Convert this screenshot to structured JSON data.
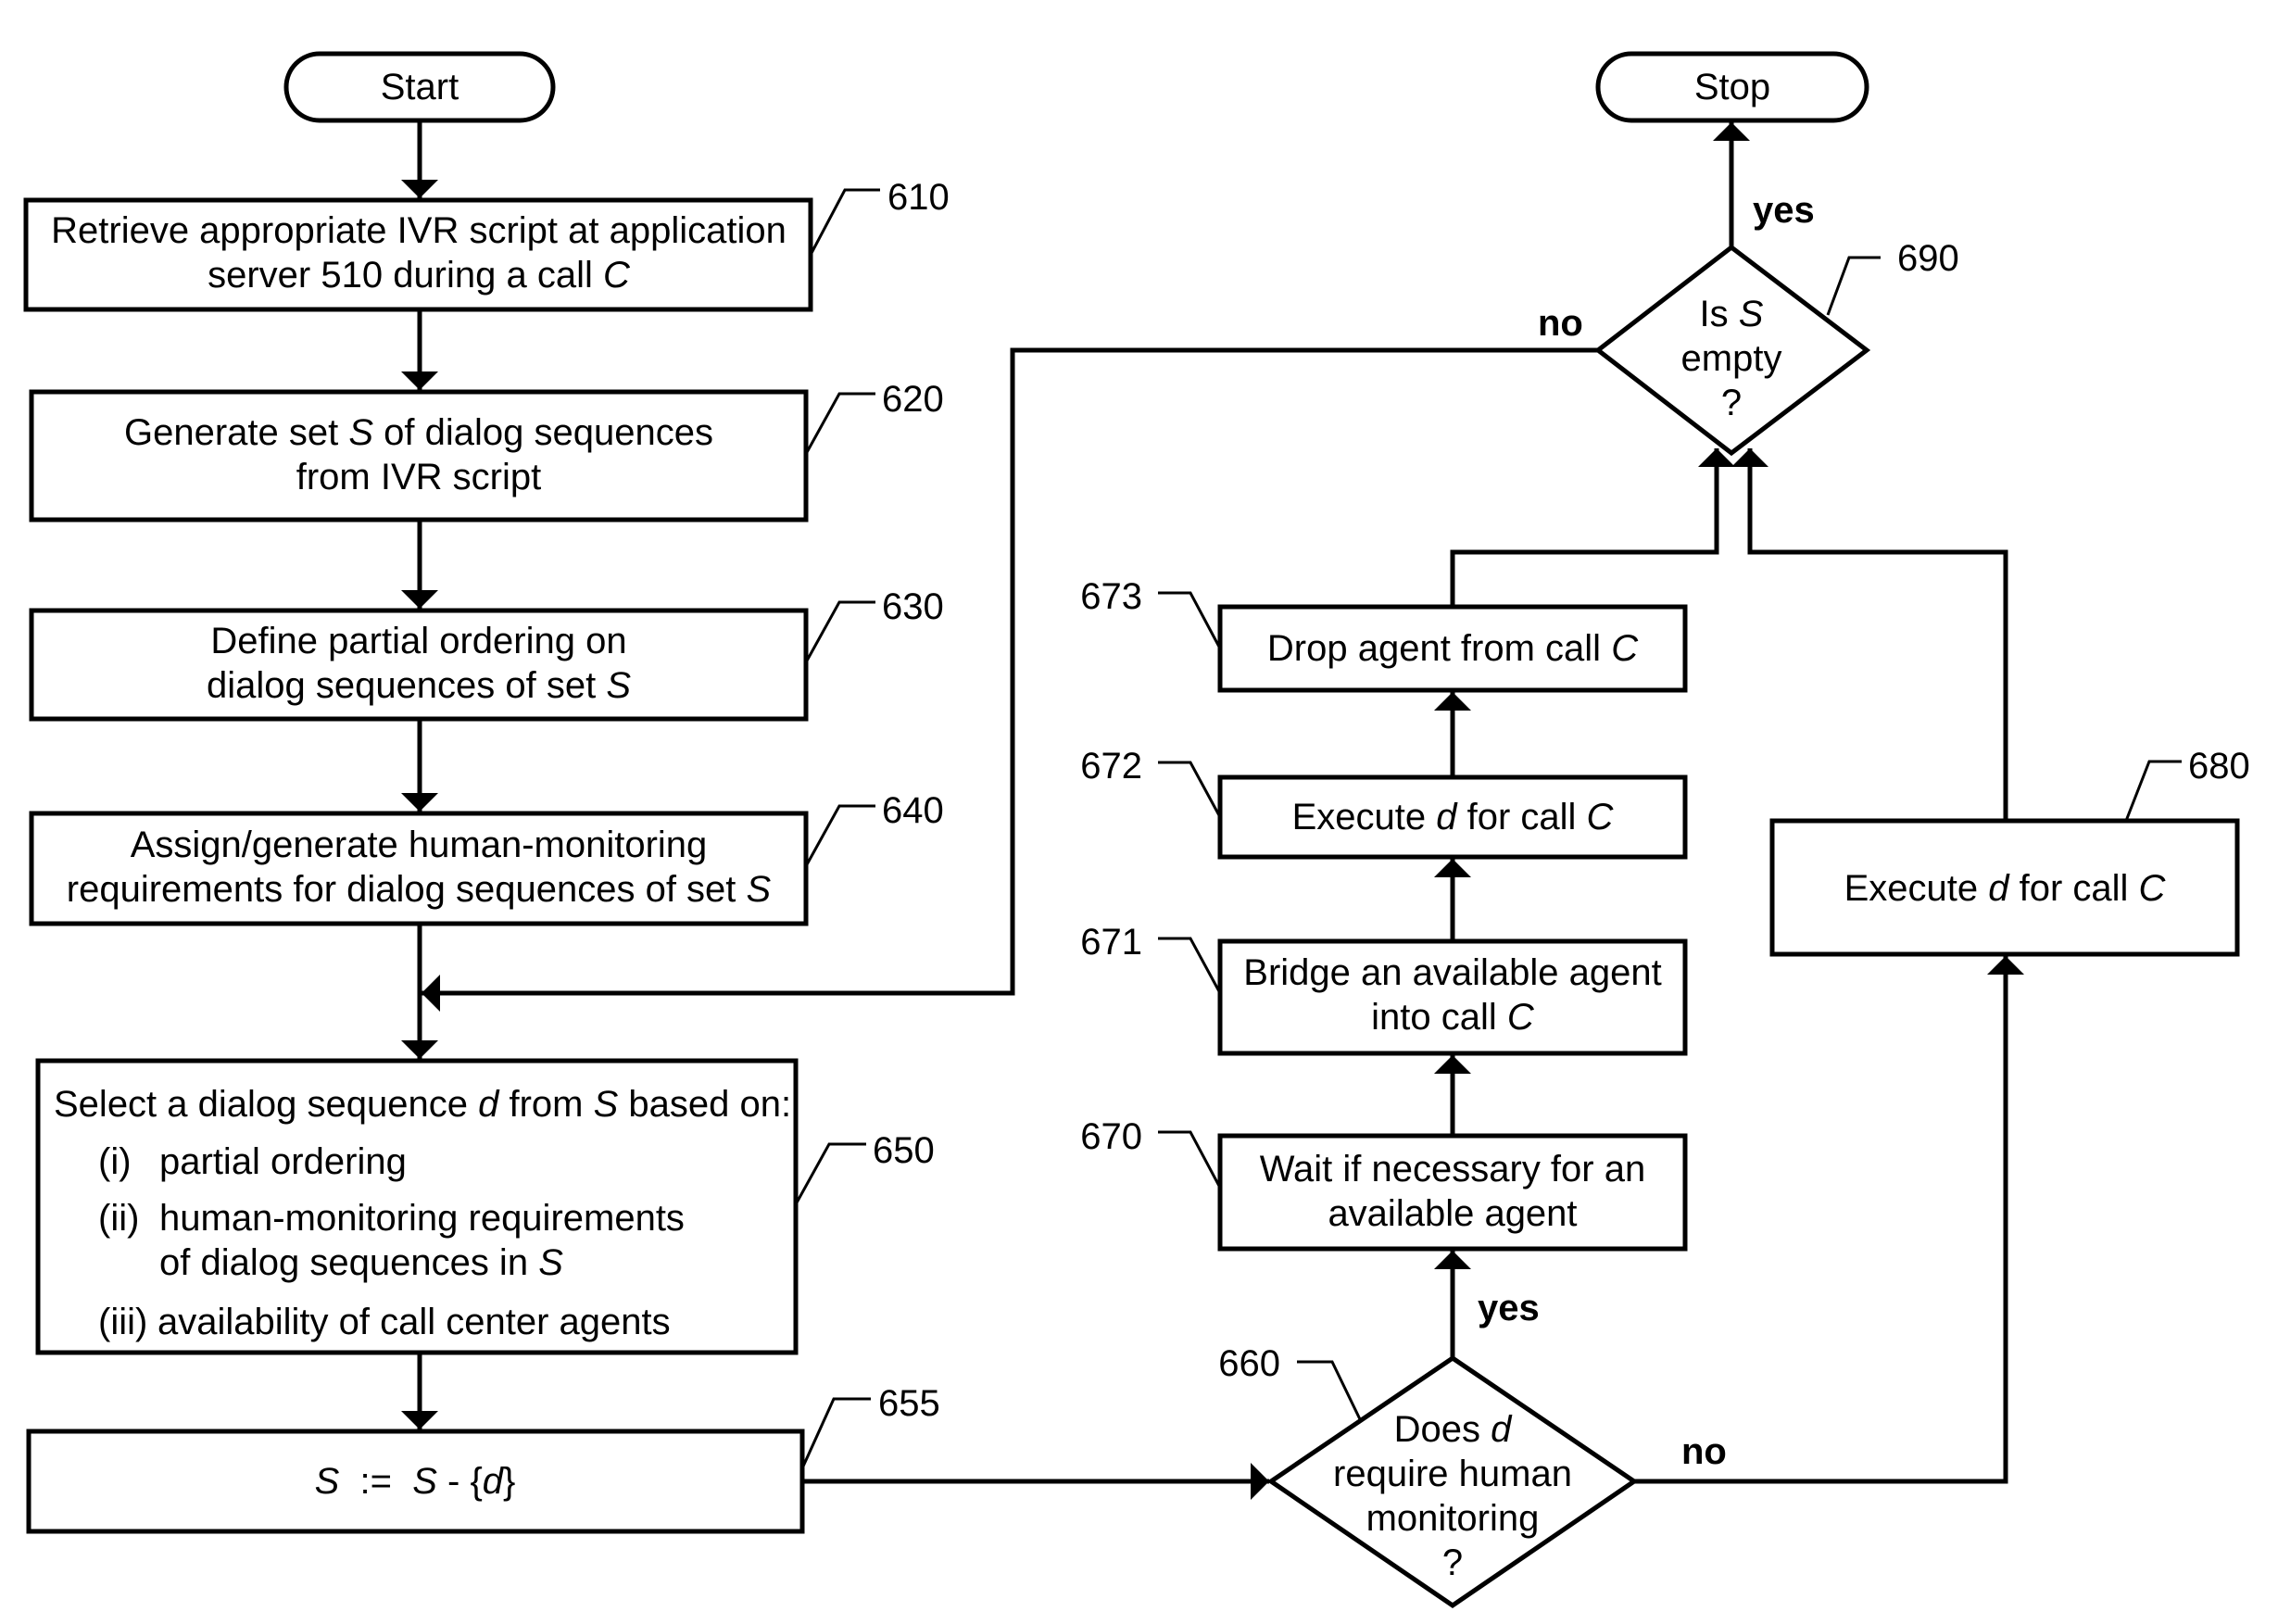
{
  "terminals": {
    "start": "Start",
    "stop": "Stop"
  },
  "steps": {
    "s610": {
      "ref": "610",
      "lines": [
        [
          "Retrieve appropriate IVR script at application"
        ],
        [
          "server 510 during a call ",
          {
            "i": "C"
          }
        ]
      ]
    },
    "s620": {
      "ref": "620",
      "lines": [
        [
          "Generate set ",
          {
            "i": "S"
          },
          " of dialog sequences"
        ],
        [
          "from IVR script"
        ]
      ]
    },
    "s630": {
      "ref": "630",
      "lines": [
        [
          "Define partial ordering on"
        ],
        [
          "dialog sequences of set ",
          {
            "i": "S"
          }
        ]
      ]
    },
    "s640": {
      "ref": "640",
      "lines": [
        [
          "Assign/generate human-monitoring"
        ],
        [
          "requirements for dialog sequences of set ",
          {
            "i": "S"
          }
        ]
      ]
    },
    "s650": {
      "ref": "650",
      "heading": [
        "Select a dialog sequence ",
        {
          "i": "d"
        },
        " from ",
        {
          "i": "S"
        },
        " based on:"
      ],
      "criteria": [
        {
          "num": "(i)",
          "lines": [
            [
              "partial ordering"
            ]
          ]
        },
        {
          "num": "(ii)",
          "lines": [
            [
              "human-monitoring requirements"
            ],
            [
              "of dialog sequences in ",
              {
                "i": "S"
              }
            ]
          ]
        },
        {
          "num": "(iii)",
          "lines": [
            [
              "availability of call center agents"
            ]
          ]
        }
      ]
    },
    "s655": {
      "ref": "655",
      "lines": [
        [
          {
            "i": "S"
          },
          "  :=  ",
          {
            "i": "S"
          },
          " - {",
          {
            "i": "d"
          },
          "}"
        ]
      ]
    },
    "s660": {
      "ref": "660",
      "lines": [
        [
          "Does ",
          {
            "i": "d"
          }
        ],
        [
          "require human"
        ],
        [
          "monitoring"
        ],
        [
          "?"
        ]
      ]
    },
    "s670": {
      "ref": "670",
      "lines": [
        [
          "Wait if necessary for an"
        ],
        [
          "available agent"
        ]
      ]
    },
    "s671": {
      "ref": "671",
      "lines": [
        [
          "Bridge an available agent"
        ],
        [
          "into call ",
          {
            "i": "C"
          }
        ]
      ]
    },
    "s672": {
      "ref": "672",
      "lines": [
        [
          "Execute ",
          {
            "i": "d"
          },
          " for call ",
          {
            "i": "C"
          }
        ]
      ]
    },
    "s673": {
      "ref": "673",
      "lines": [
        [
          "Drop agent from call ",
          {
            "i": "C"
          }
        ]
      ]
    },
    "s680": {
      "ref": "680",
      "lines": [
        [
          "Execute ",
          {
            "i": "d"
          },
          " for call ",
          {
            "i": "C"
          }
        ]
      ]
    },
    "s690": {
      "ref": "690",
      "lines": [
        [
          "Is ",
          {
            "i": "S"
          }
        ],
        [
          "empty"
        ],
        [
          "?"
        ]
      ]
    }
  },
  "branch_labels": {
    "d660_yes": "yes",
    "d660_no": "no",
    "d690_yes": "yes",
    "d690_no": "no"
  }
}
